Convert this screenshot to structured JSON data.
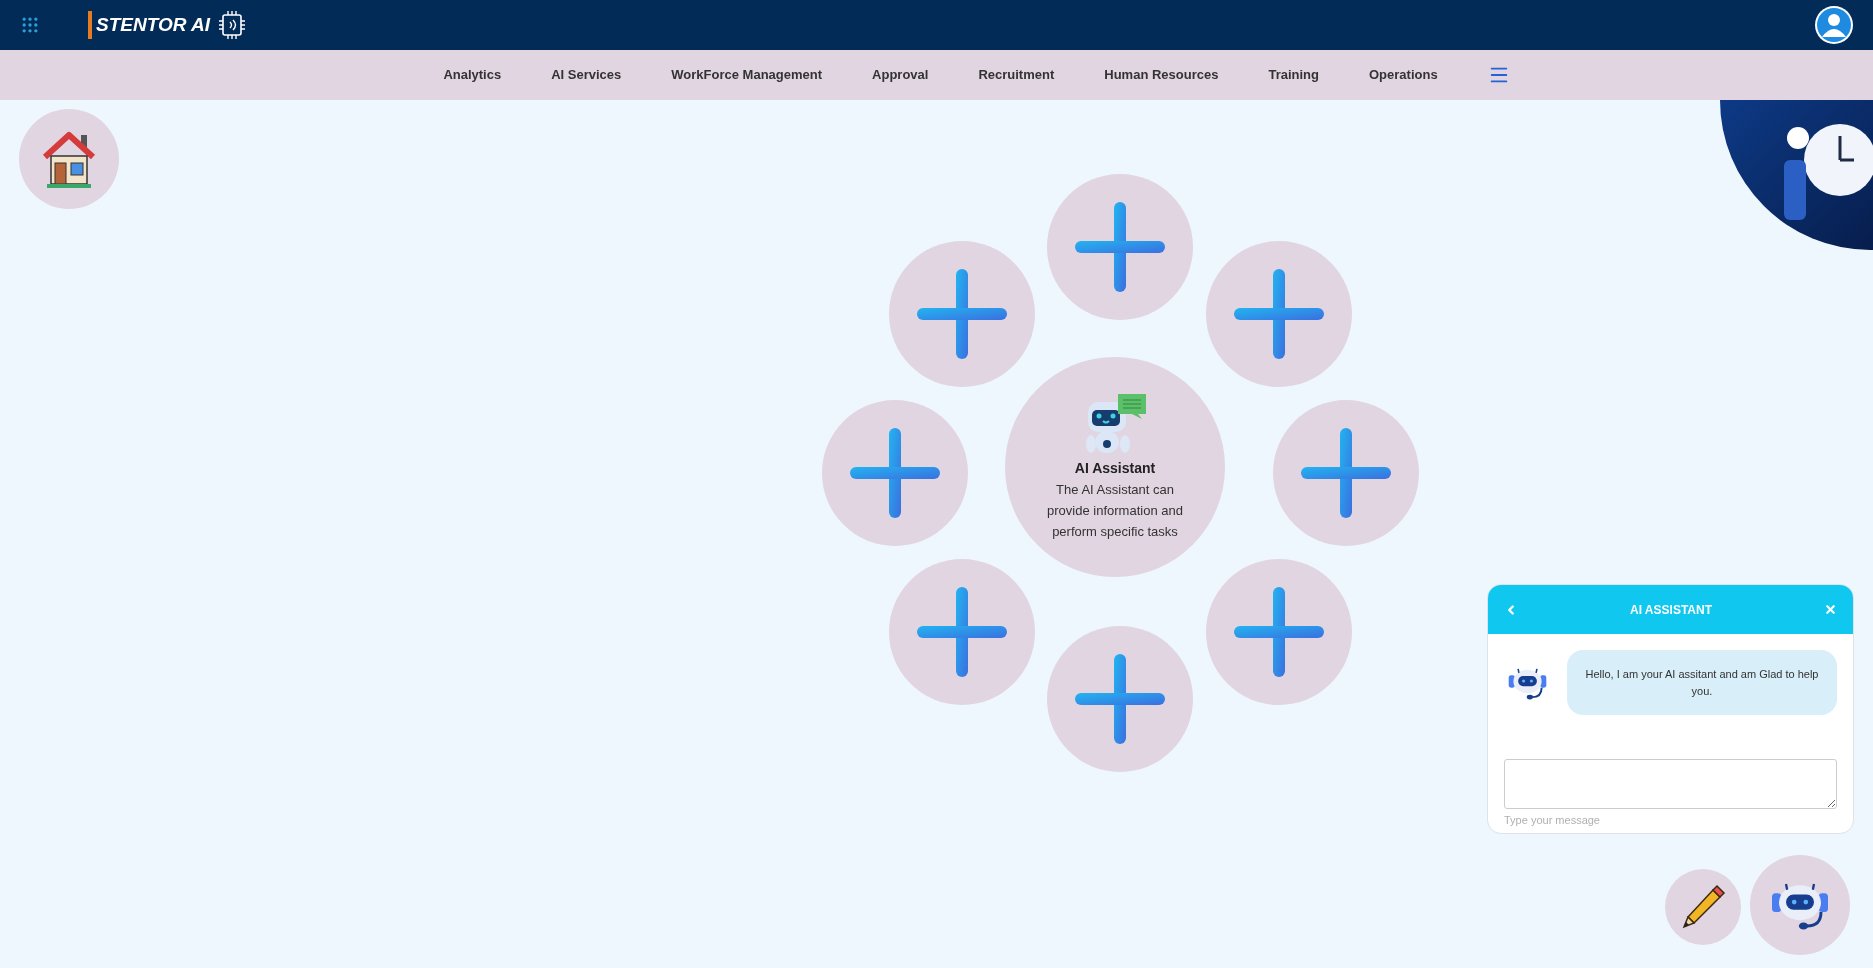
{
  "header": {
    "brand": "STENTOR AI"
  },
  "nav": {
    "items": [
      "Analytics",
      "AI Services",
      "WorkForce Management",
      "Approval",
      "Recruitment",
      "Human Resources",
      "Training",
      "Operations"
    ]
  },
  "hub": {
    "title": "AI Assistant",
    "description": "The AI Assistant can provide information and perform specific tasks"
  },
  "chat": {
    "title": "AI ASSISTANT",
    "message": "Hello, I am your AI assitant and am Glad to help you.",
    "hint": "Type your message"
  }
}
